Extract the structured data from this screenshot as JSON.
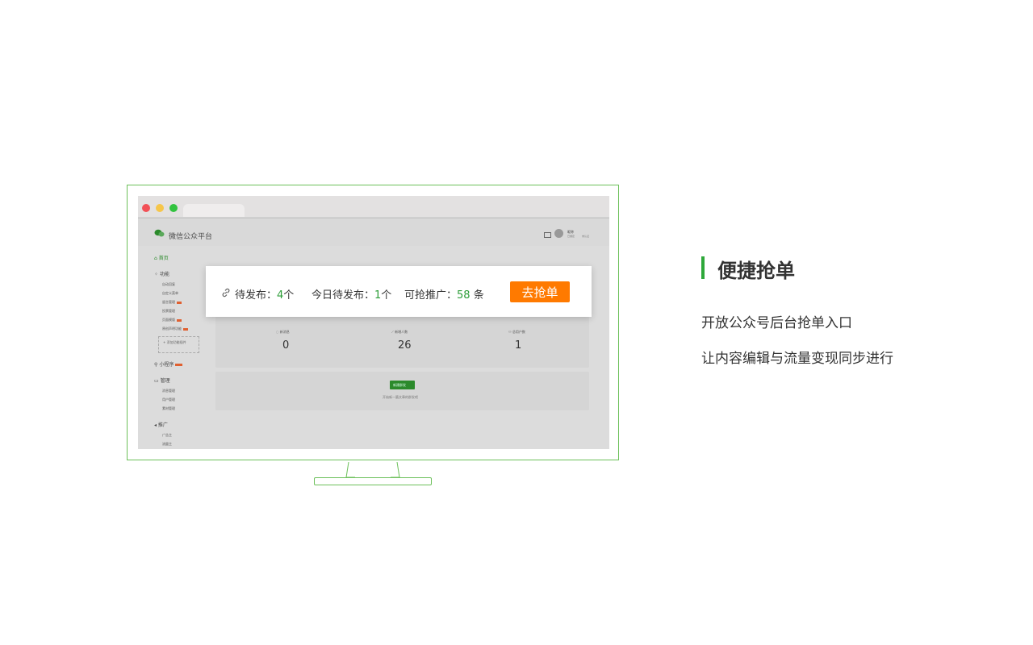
{
  "brand": "微信公众平台",
  "header": {
    "user_name": "昵称",
    "user_sub": "已绑定",
    "user_sub2": "未认证"
  },
  "sidebar": {
    "home": "首页",
    "functions": "功能",
    "function_items": [
      "自动回复",
      "自定义菜单",
      "留言管理",
      "投票管理",
      "页面模版",
      "原创声明功能"
    ],
    "add_plugin": "+ 添加功能插件",
    "mini_program": "小程序",
    "manage": "管理",
    "manage_items": [
      "消息管理",
      "用户管理",
      "素材管理"
    ],
    "promote": "推广",
    "promote_items": [
      "广告主",
      "流量主"
    ]
  },
  "stats": [
    {
      "label": "新消息",
      "value": "0"
    },
    {
      "label": "新增人数",
      "value": "26"
    },
    {
      "label": "总用户数",
      "value": "1"
    }
  ],
  "create_button": "新建群发",
  "create_hint": "开始新一篇文章的群发吧",
  "popup": {
    "pending_label": "待发布：",
    "pending_value": "4",
    "pending_unit": "个",
    "today_label": "今日待发布：",
    "today_value": "1",
    "today_unit": "个",
    "promo_label": "可抢推广：",
    "promo_value": "58",
    "promo_unit": " 条",
    "grab_button": "去抢单"
  },
  "feature": {
    "title": "便捷抢单",
    "line1": "开放公众号后台抢单入口",
    "line2": "让内容编辑与流量变现同步进行"
  },
  "colors": {
    "accent_green": "#2ea83a",
    "frame_green": "#6cc05a",
    "orange": "#ff7a00",
    "number_green": "#2b9c37"
  }
}
